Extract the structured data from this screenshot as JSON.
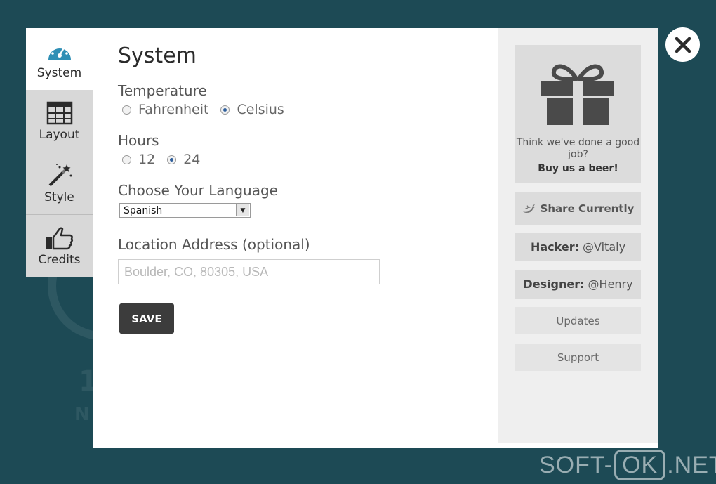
{
  "tabs": [
    {
      "label": "System",
      "icon": "dashboard-icon",
      "active": true
    },
    {
      "label": "Layout",
      "icon": "grid-icon"
    },
    {
      "label": "Style",
      "icon": "magic-wand-icon"
    },
    {
      "label": "Credits",
      "icon": "thumbs-up-icon"
    }
  ],
  "main": {
    "title": "System",
    "temperature": {
      "label": "Temperature",
      "options": [
        "Fahrenheit",
        "Celsius"
      ],
      "selected": "Celsius"
    },
    "hours": {
      "label": "Hours",
      "options": [
        "12",
        "24"
      ],
      "selected": "24"
    },
    "language": {
      "label": "Choose Your Language",
      "selected": "Spanish"
    },
    "location": {
      "label": "Location Address (optional)",
      "placeholder": "Boulder, CO, 80305, USA"
    },
    "save_label": "SAVE"
  },
  "sidebar": {
    "beer": {
      "line1": "Think we've done a good job?",
      "line2": "Buy us a beer!"
    },
    "share": "Share Currently",
    "hacker": {
      "role": "Hacker:",
      "handle": "@Vitaly"
    },
    "designer": {
      "role": "Designer:",
      "handle": "@Henry"
    },
    "updates": "Updates",
    "support": "Support"
  },
  "watermark": {
    "left": "SOFT-",
    "box": "OK",
    "right": ".NET"
  },
  "colors": {
    "background": "#1d4a55",
    "accent": "#2f8fb5",
    "save": "#3c3c3c"
  }
}
